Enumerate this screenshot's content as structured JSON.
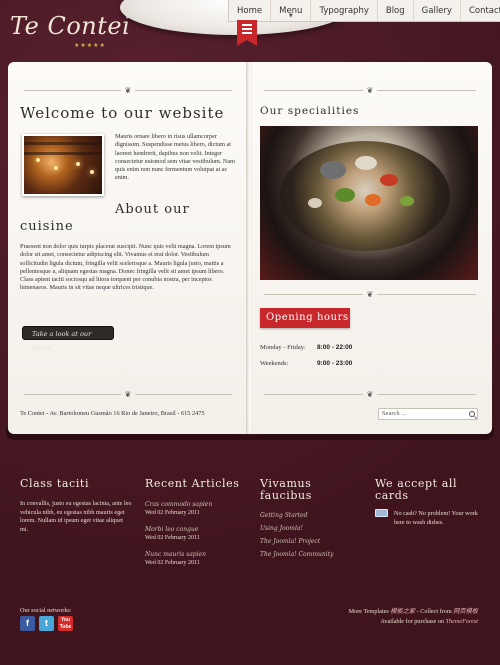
{
  "header": {
    "logo": "Te Contei",
    "logo_stars": "★★★★★",
    "nav": [
      {
        "label": "Home"
      },
      {
        "label": "Menu",
        "arrow": "▼"
      },
      {
        "label": "Typography"
      },
      {
        "label": "Blog"
      },
      {
        "label": "Gallery"
      },
      {
        "label": "Contact"
      }
    ]
  },
  "left_page": {
    "welcome_title": "Welcome to our website",
    "intro": "Mauris ornare libero in risus ullamcorper dignissim. Suspendisse metus libero, dictum at laoreet hendrerit, dapibus non velit. Integer consectetur euismod sem vitae vestibulum. Nam quis enim non nunc fermentum volutpat at ac enim.",
    "about_title_1": "About our",
    "about_title_2": "cuisine",
    "about_text": "Praesent non dolor quis turpis placerat suscipit. Nunc quis velit magna. Lorem ipsum dolor sit amet, consectetur adipiscing elit. Vivamus et erat dolor. Vestibulum sollicitudin ligula dictum, fringilla velit scelerisque a. Mauris ligula justo, mattis a pellentesque a, aliquam egestas magna. Donec fringilla velit sit amet ipsum libero. Class aptent taciti sociosqu ad litora torquent per conubia nostra, per inceptos himenaeos. Mauris in sit vitae neque ultrices tristique.",
    "menu_button": "Take a look at our menu!",
    "address": "Te Contei - Av. Bartolomeu Gusmão 16 Rio de Janeiro, Brasil - 615 2475"
  },
  "right_page": {
    "specialities_title": "Our specialities",
    "opening_title": "Opening hours",
    "hours": [
      {
        "day": "Monday - Friday:",
        "time": "8:00 - 22:00"
      },
      {
        "day": "Weekends:",
        "time": "9:00 - 23:00"
      }
    ],
    "search_placeholder": "Search ..."
  },
  "footer": {
    "col1": {
      "title": "Class taciti",
      "text": "In convallis, justo eu egestas lacinia, ante leo vehicula nibh, eu egestas nibh mauris eget lorem. Nullam id ipsum eget vitae aliquet mi."
    },
    "col2": {
      "title": "Recent Articles",
      "articles": [
        {
          "title": "Cras commodo sapien",
          "date": "Wed 02 February 2011"
        },
        {
          "title": "Morbi leo congue",
          "date": "Wed 02 February 2011"
        },
        {
          "title": "Nunc mauris sapien",
          "date": "Wed 02 February 2011"
        }
      ]
    },
    "col3": {
      "title_1": "Vivamus",
      "title_2": "faucibus",
      "links": [
        "Getting Started",
        "Using Joomla!",
        "The Joomla! Project",
        "The Joomla! Community"
      ]
    },
    "col4": {
      "title_1": "We accept all",
      "title_2": "cards",
      "text": "No cash? No problem! Your work here to wash dishes."
    },
    "social_label": "Our social networks:",
    "social": {
      "fb": "f",
      "tw": "t",
      "yt": "You Tube"
    },
    "credits_1a": "More Templates ",
    "credits_1b": "模板之家",
    "credits_1c": " - Collect from ",
    "credits_1d": "网页模板",
    "credits_2a": "Available for purchase on ",
    "credits_2b": "ThemeForest"
  },
  "colors": {
    "background": "#4a1a24",
    "accent": "#c8282c",
    "page": "#faf7f3"
  }
}
